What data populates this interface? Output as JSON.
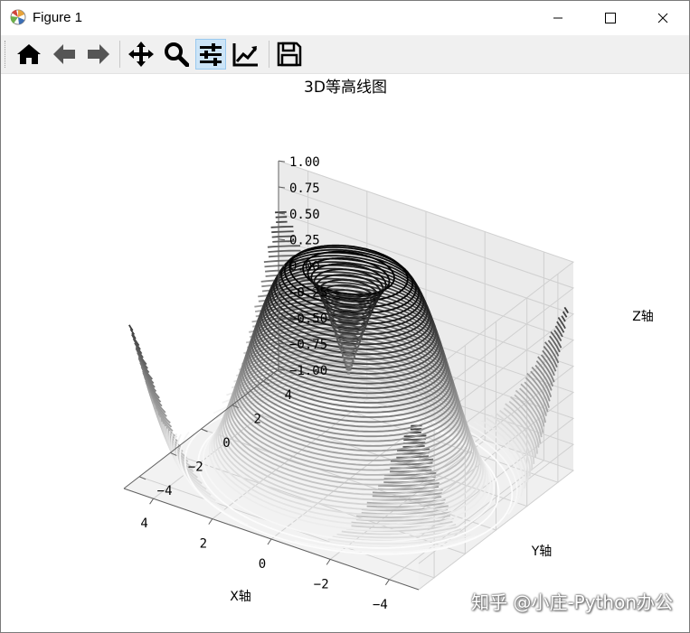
{
  "window": {
    "title": "Figure 1"
  },
  "toolbar": {
    "buttons": [
      "home-icon",
      "back-icon",
      "forward-icon",
      "pan-icon",
      "zoom-icon",
      "configure-subplots-icon",
      "edit-axis-icon",
      "save-icon"
    ],
    "active": "configure-subplots-icon"
  },
  "watermark": "知乎 @小庄-Python办公",
  "chart_data": {
    "type": "contour3d",
    "title": "3D等高线图",
    "xlabel": "X轴",
    "ylabel": "Y轴",
    "zlabel": "Z轴",
    "function": "z = sin(sqrt(x^2 + y^2))",
    "xlim": [
      -5,
      5
    ],
    "ylim": [
      -5,
      5
    ],
    "zlim": [
      -1,
      1
    ],
    "x_ticks": [
      "−4",
      "−2",
      "0",
      "2",
      "4"
    ],
    "y_ticks": [
      "−4",
      "−2",
      "0",
      "2",
      "4"
    ],
    "z_ticks": [
      "−1.00",
      "−0.75",
      "−0.50",
      "−0.25",
      "0.00",
      "0.25",
      "0.50",
      "0.75",
      "1.00"
    ],
    "levels": 50,
    "colormap": "binary",
    "grid": true
  }
}
